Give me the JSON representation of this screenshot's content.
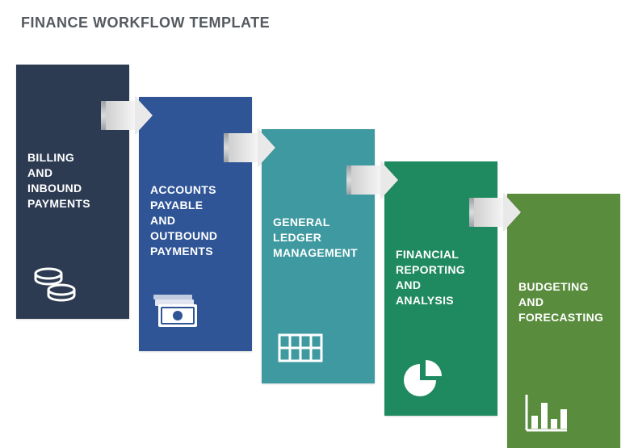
{
  "title": "FINANCE WORKFLOW TEMPLATE",
  "cards": [
    {
      "label": "BILLING\nAND\nINBOUND\nPAYMENTS",
      "color": "#2d3b52",
      "icon": "coins-icon"
    },
    {
      "label": "ACCOUNTS\nPAYABLE\nAND\nOUTBOUND\nPAYMENTS",
      "color": "#2f5597",
      "icon": "cash-icon"
    },
    {
      "label": "GENERAL\nLEDGER\nMANAGEMENT",
      "color": "#3e9aa0",
      "icon": "ledger-grid-icon"
    },
    {
      "label": "FINANCIAL\nREPORTING\nAND\nANALYSIS",
      "color": "#1f8a60",
      "icon": "pie-chart-icon"
    },
    {
      "label": "BUDGETING\nAND\nFORECASTING",
      "color": "#5a8c3e",
      "icon": "bar-chart-icon"
    }
  ]
}
